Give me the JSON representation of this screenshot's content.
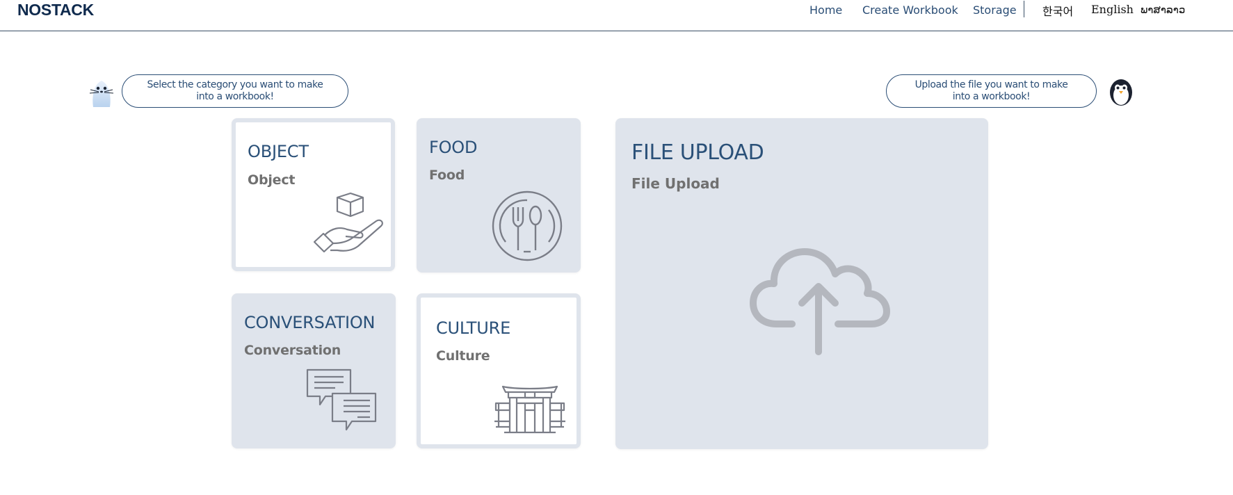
{
  "header": {
    "logo": "NOSTACK",
    "nav": {
      "home": "Home",
      "create_workbook": "Create Workbook",
      "storage": "Storage"
    },
    "languages": {
      "korean": "한국어",
      "english": "English",
      "lao": "ພາສາລາວ"
    }
  },
  "prompts": {
    "category": "Select the category you want to make into a workbook!",
    "upload": "Upload the file you want to make into a workbook!"
  },
  "categories": [
    {
      "title": "OBJECT",
      "subtitle": "Object",
      "icon": "hand-box-icon",
      "selected": true
    },
    {
      "title": "FOOD",
      "subtitle": "Food",
      "icon": "fork-spoon-plate-icon",
      "selected": false
    },
    {
      "title": "CONVERSATION",
      "subtitle": "Conversation",
      "icon": "chat-bubbles-icon",
      "selected": false
    },
    {
      "title": "CULTURE",
      "subtitle": "Culture",
      "icon": "gate-icon",
      "selected": true
    }
  ],
  "upload": {
    "title": "FILE UPLOAD",
    "subtitle": "File Upload",
    "icon": "cloud-upload-icon"
  },
  "colors": {
    "brand": "#0f2a4d",
    "accent": "#2a5078",
    "card_bg": "#dfe4ec",
    "icon_gray": "#7a7d87"
  }
}
